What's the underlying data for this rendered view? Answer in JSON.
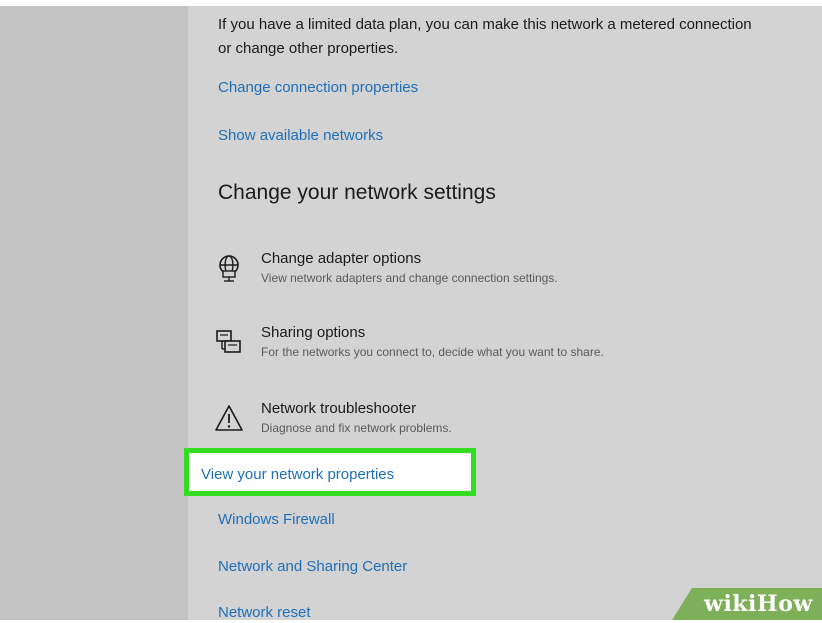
{
  "intro_text": "If you have a limited data plan, you can make this network a metered connection or change other properties.",
  "links": {
    "change_connection": "Change connection properties",
    "show_networks": "Show available networks"
  },
  "section_heading": "Change your network settings",
  "settings": [
    {
      "title": "Change adapter options",
      "description": "View network adapters and change connection settings.",
      "icon": "network-adapter-icon"
    },
    {
      "title": "Sharing options",
      "description": "For the networks you connect to, decide what you want to share.",
      "icon": "sharing-icon"
    },
    {
      "title": "Network troubleshooter",
      "description": "Diagnose and fix network problems.",
      "icon": "warning-icon"
    }
  ],
  "related_links": {
    "view_properties": "View your network properties",
    "windows_firewall": "Windows Firewall",
    "sharing_center": "Network and Sharing Center",
    "network_reset": "Network reset"
  },
  "watermark": {
    "wiki": "wiki",
    "how": "How"
  },
  "colors": {
    "link": "#1f6fb8",
    "highlight": "#33dd22",
    "watermark_bg": "#7eaf59"
  }
}
